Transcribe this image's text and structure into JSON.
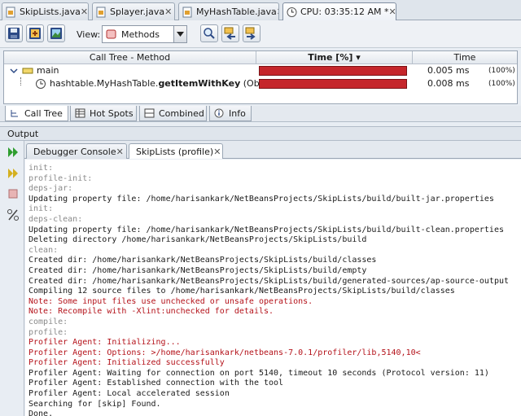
{
  "editor_tabs": [
    {
      "label": "SkipLists.java",
      "type": "java"
    },
    {
      "label": "Splayer.java",
      "type": "java"
    },
    {
      "label": "MyHashTable.java",
      "type": "java"
    },
    {
      "label": "CPU: 03:35:12 AM *",
      "type": "cpu"
    }
  ],
  "toolbar": {
    "view_label": "View:",
    "view_value": "Methods"
  },
  "call_tree": {
    "headers": [
      "Call Tree - Method",
      "Time [%] ▾",
      "Time"
    ],
    "rows": [
      {
        "method": "main",
        "method_prefix": "",
        "method_bold": "",
        "method_suffix": "",
        "time_pct": 1.0,
        "time": "0.005 ms",
        "pct_text": "(100%)"
      },
      {
        "method": "",
        "method_prefix": "hashtable.MyHashTable.",
        "method_bold": "getItemWithKey",
        "method_suffix": " (Object)",
        "time_pct": 1.0,
        "time": "0.008 ms",
        "pct_text": "(100%)"
      }
    ]
  },
  "view_tabs": [
    "Call Tree",
    "Hot Spots",
    "Combined",
    "Info"
  ],
  "output": {
    "title": "Output",
    "tabs": [
      "Debugger Console",
      "SkipLists (profile)"
    ],
    "lines": [
      {
        "t": "init:",
        "c": "gray"
      },
      {
        "t": "profile-init:",
        "c": "gray"
      },
      {
        "t": "deps-jar:",
        "c": "gray"
      },
      {
        "t": "Updating property file: /home/harisankark/NetBeansProjects/SkipLists/build/built-jar.properties",
        "c": "normal"
      },
      {
        "t": "init:",
        "c": "gray"
      },
      {
        "t": "deps-clean:",
        "c": "gray"
      },
      {
        "t": "Updating property file: /home/harisankark/NetBeansProjects/SkipLists/build/built-clean.properties",
        "c": "normal"
      },
      {
        "t": "Deleting directory /home/harisankark/NetBeansProjects/SkipLists/build",
        "c": "normal"
      },
      {
        "t": "clean:",
        "c": "gray"
      },
      {
        "t": "Created dir: /home/harisankark/NetBeansProjects/SkipLists/build/classes",
        "c": "normal"
      },
      {
        "t": "Created dir: /home/harisankark/NetBeansProjects/SkipLists/build/empty",
        "c": "normal"
      },
      {
        "t": "Created dir: /home/harisankark/NetBeansProjects/SkipLists/build/generated-sources/ap-source-output",
        "c": "normal"
      },
      {
        "t": "Compiling 12 source files to /home/harisankark/NetBeansProjects/SkipLists/build/classes",
        "c": "normal"
      },
      {
        "t": "Note: Some input files use unchecked or unsafe operations.",
        "c": "red"
      },
      {
        "t": "Note: Recompile with -Xlint:unchecked for details.",
        "c": "red"
      },
      {
        "t": "compile:",
        "c": "gray"
      },
      {
        "t": "profile:",
        "c": "gray"
      },
      {
        "t": "Profiler Agent: Initializing...",
        "c": "red"
      },
      {
        "t": "Profiler Agent: Options: >/home/harisankark/netbeans-7.0.1/profiler/lib,5140,10<",
        "c": "red"
      },
      {
        "t": "Profiler Agent: Initialized successfully",
        "c": "red"
      },
      {
        "t": "Profiler Agent: Waiting for connection on port 5140, timeout 10 seconds (Protocol version: 11)",
        "c": "normal"
      },
      {
        "t": "Profiler Agent: Established connection with the tool",
        "c": "normal"
      },
      {
        "t": "Profiler Agent: Local accelerated session",
        "c": "normal"
      },
      {
        "t": "Searching for [skip] Found.",
        "c": "normal"
      },
      {
        "t": "Done.",
        "c": "normal"
      }
    ]
  },
  "colors": {
    "bar": "#c5262b",
    "note_red": "#b4121a",
    "label_gray": "#8a8a8a"
  }
}
